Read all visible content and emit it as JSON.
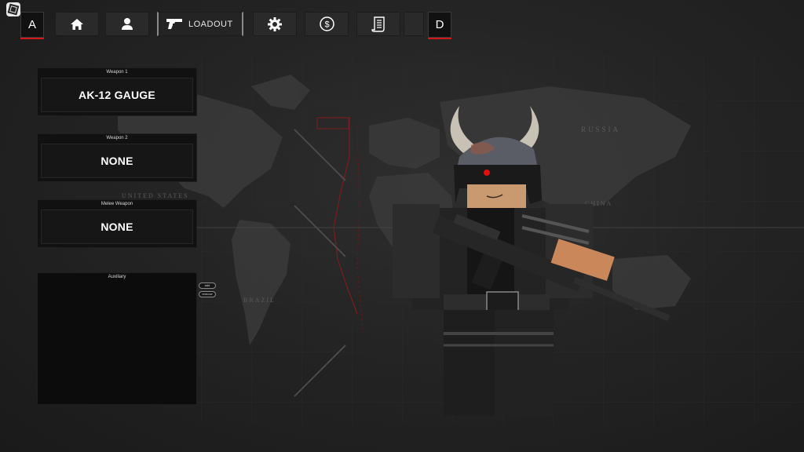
{
  "topbar": {
    "left_key": "A",
    "right_key": "D",
    "tabs": [
      {
        "id": "home",
        "icon": "home-icon"
      },
      {
        "id": "profile",
        "icon": "user-icon"
      },
      {
        "id": "loadout",
        "icon": "pistol-icon",
        "label": "LOADOUT",
        "active": true
      },
      {
        "id": "settings",
        "icon": "gear-icon"
      },
      {
        "id": "shop",
        "icon": "dollar-icon"
      },
      {
        "id": "log",
        "icon": "scroll-icon"
      },
      {
        "id": "empty",
        "icon": ""
      }
    ]
  },
  "loadout": {
    "weapon1": {
      "title": "Weapon 1",
      "value": "AK-12 GAUGE"
    },
    "weapon2": {
      "title": "Weapon 2",
      "value": "NONE"
    },
    "melee": {
      "title": "Melee Weapon",
      "value": "NONE"
    },
    "auxiliary": {
      "title": "Auxiliary",
      "add_label": "add",
      "remove_label": "remove"
    }
  },
  "map_labels": {
    "russia": "RUSSIA",
    "china": "CHINA",
    "united_states": "UNITED STATES",
    "brazil": "BRAZIL"
  },
  "colors": {
    "accent_red": "#d01818",
    "panel": "#111111",
    "background": "#202020"
  }
}
